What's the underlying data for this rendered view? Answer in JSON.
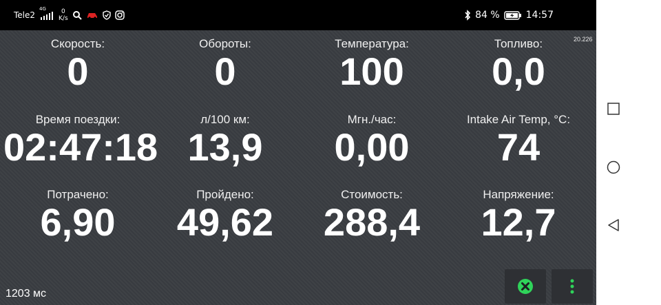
{
  "status_bar": {
    "carrier": "Tele2",
    "network_type": "4G",
    "net_speed_value": "0",
    "net_speed_unit": "K/s",
    "battery_percent": "84 %",
    "time": "14:57",
    "icons": [
      "signal-icon",
      "search-icon",
      "car-icon",
      "shield-icon",
      "instagram-icon",
      "bluetooth-icon",
      "battery-icon"
    ]
  },
  "version": "20.226",
  "gauges": [
    {
      "label": "Скорость:",
      "value": "0"
    },
    {
      "label": "Обороты:",
      "value": "0"
    },
    {
      "label": "Температура:",
      "value": "100"
    },
    {
      "label": "Топливо:",
      "value": "0,0"
    },
    {
      "label": "Время поездки:",
      "value": "02:47:18"
    },
    {
      "label": "л/100 км:",
      "value": "13,9"
    },
    {
      "label": "Мгн./час:",
      "value": "0,00"
    },
    {
      "label": "Intake Air Temp, °C:",
      "value": "74"
    },
    {
      "label": "Потрачено:",
      "value": "6,90"
    },
    {
      "label": "Пройдено:",
      "value": "49,62"
    },
    {
      "label": "Стоимость:",
      "value": "288,4"
    },
    {
      "label": "Напряжение:",
      "value": "12,7"
    }
  ],
  "latency": "1203 мс",
  "colors": {
    "accent_green": "#2fd35a",
    "background": "#3a3d42"
  },
  "nav_bar": {
    "icons": [
      "square-icon",
      "circle-icon",
      "triangle-back-icon"
    ]
  }
}
